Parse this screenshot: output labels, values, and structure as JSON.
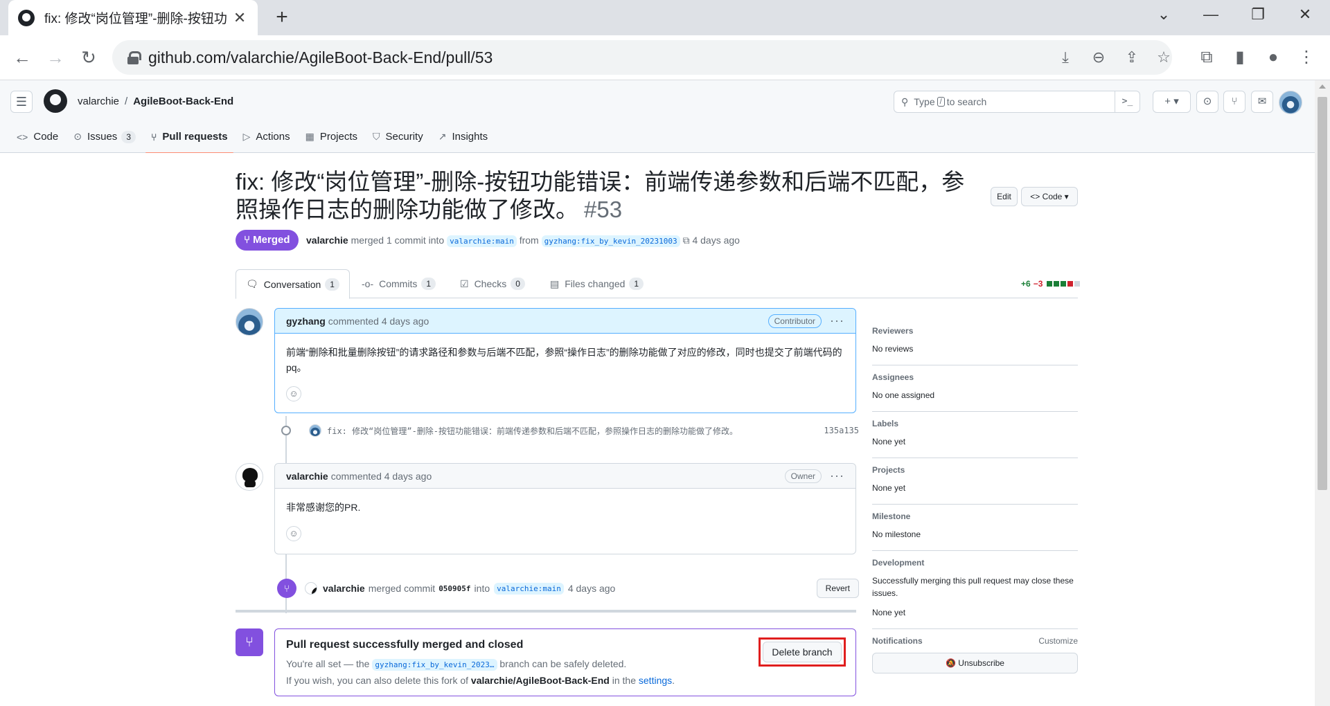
{
  "browser": {
    "tab_title": "fix: 修改“岗位管理”-删除-按钮功",
    "new_tab": "+",
    "url": "github.com/valarchie/AgileBoot-Back-End/pull/53"
  },
  "header": {
    "owner": "valarchie",
    "separator": "/",
    "repo": "AgileBoot-Back-End",
    "search_pre": "Type",
    "search_key": "/",
    "search_post": "to search",
    "search_cmd": ">_",
    "plus_label": "+ ▾"
  },
  "repo_tabs": [
    {
      "label": "Code",
      "count": ""
    },
    {
      "label": "Issues",
      "count": "3"
    },
    {
      "label": "Pull requests",
      "count": ""
    },
    {
      "label": "Actions",
      "count": ""
    },
    {
      "label": "Projects",
      "count": ""
    },
    {
      "label": "Security",
      "count": ""
    },
    {
      "label": "Insights",
      "count": ""
    }
  ],
  "pr": {
    "title": "fix: 修改“岗位管理”-删除-按钮功能错误：前端传递参数和后端不匹配，参照操作日志的删除功能做了修改。",
    "number": "#53",
    "edit_label": "Edit",
    "code_label": "<> Code ▾",
    "state": "Merged",
    "merger": "valarchie",
    "merged_text": "merged 1 commit into",
    "base_branch": "valarchie:main",
    "from_text": "from",
    "head_branch": "gyzhang:fix_by_kevin_20231003",
    "time": "4 days ago"
  },
  "pr_tabs": [
    {
      "label": "Conversation",
      "count": "1"
    },
    {
      "label": "Commits",
      "count": "1"
    },
    {
      "label": "Checks",
      "count": "0"
    },
    {
      "label": "Files changed",
      "count": "1"
    }
  ],
  "diffstat": {
    "additions": "+6",
    "deletions": "−3"
  },
  "comments": [
    {
      "author": "gyzhang",
      "action": "commented 4 days ago",
      "role": "Contributor",
      "body": "前端“删除和批量删除按钮”的请求路径和参数与后端不匹配，参照“操作日志”的删除功能做了对应的修改，同时也提交了前端代码的pq。"
    },
    {
      "author": "valarchie",
      "action": "commented 4 days ago",
      "role": "Owner",
      "body": "非常感谢您的PR."
    }
  ],
  "commit": {
    "message": "fix: 修改“岗位管理”-删除-按钮功能错误：前端传递参数和后端不匹配，参照操作日志的删除功能做了修改。",
    "sha": "135a135"
  },
  "merge_event": {
    "author": "valarchie",
    "text1": "merged commit",
    "sha": "050905f",
    "text2": "into",
    "branch": "valarchie:main",
    "time": "4 days ago",
    "revert_label": "Revert"
  },
  "merge_box": {
    "title": "Pull request successfully merged and closed",
    "line1_pre": "You're all set — the",
    "line1_branch": "gyzhang:fix_by_kevin_2023…",
    "line1_post": "branch can be safely deleted.",
    "line2_pre": "If you wish, you can also delete this fork of",
    "line2_repo": "valarchie/AgileBoot-Back-End",
    "line2_mid": "in the",
    "line2_link": "settings",
    "line2_end": ".",
    "delete_label": "Delete branch"
  },
  "sidebar": {
    "reviewers_label": "Reviewers",
    "reviewers_value": "No reviews",
    "assignees_label": "Assignees",
    "assignees_value": "No one assigned",
    "labels_label": "Labels",
    "labels_value": "None yet",
    "projects_label": "Projects",
    "projects_value": "None yet",
    "milestone_label": "Milestone",
    "milestone_value": "No milestone",
    "development_label": "Development",
    "development_text": "Successfully merging this pull request may close these issues.",
    "development_value": "None yet",
    "notifications_label": "Notifications",
    "customize_label": "Customize",
    "unsubscribe_label": "Unsubscribe"
  },
  "colors": {
    "merged": "#8250df",
    "link": "#0969da",
    "highlight_border": "#54aeff",
    "delete_outline": "#e01e1e"
  }
}
